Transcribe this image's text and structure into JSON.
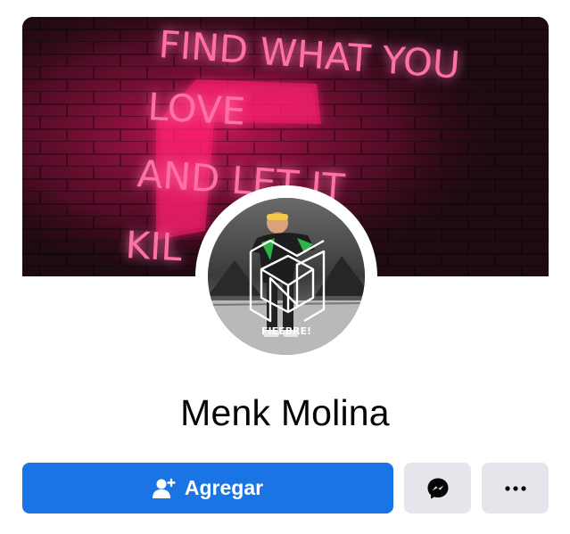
{
  "profile": {
    "name": "Menk Molina",
    "avatar_caption": "FIEEBRE!"
  },
  "cover": {
    "neon_lines": [
      "FIND WHAT YOU",
      "LOVE",
      "AND LET IT",
      "KIL"
    ]
  },
  "actions": {
    "add_label": "Agregar",
    "add_icon": "add-friend-icon",
    "messenger_icon": "messenger-icon",
    "more_icon": "more-icon"
  },
  "colors": {
    "primary_button": "#1b74e4",
    "secondary_button": "#e4e6eb",
    "neon": "#ff2d7a"
  }
}
